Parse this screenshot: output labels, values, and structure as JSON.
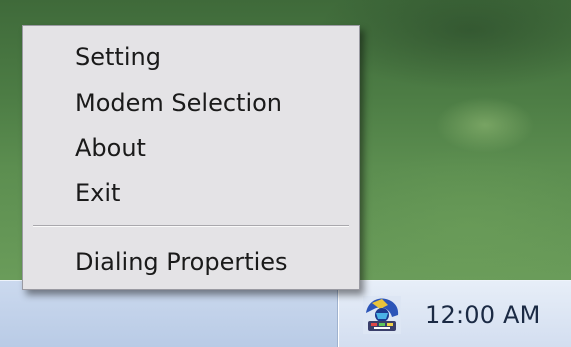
{
  "context_menu": {
    "items": [
      {
        "label": "Setting"
      },
      {
        "label": "Modem Selection"
      },
      {
        "label": "About"
      },
      {
        "label": "Exit"
      }
    ],
    "extra_item": {
      "label": "Dialing Properties"
    }
  },
  "taskbar": {
    "tray_icon": "dialer-app-icon",
    "clock": "12:00 AM"
  }
}
